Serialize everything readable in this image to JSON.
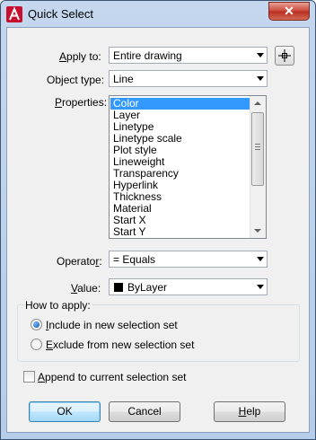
{
  "window": {
    "title": "Quick Select",
    "close_symbol": "✕",
    "app_icon": "autocad-logo-icon"
  },
  "apply_to": {
    "label": "Apply to:",
    "value": "Entire drawing"
  },
  "object_type": {
    "label": "Object type:",
    "value": "Line"
  },
  "properties": {
    "label": "Properties:",
    "items": [
      "Color",
      "Layer",
      "Linetype",
      "Linetype scale",
      "Plot style",
      "Lineweight",
      "Transparency",
      "Hyperlink",
      "Thickness",
      "Material",
      "Start X",
      "Start Y"
    ],
    "selected": "Color"
  },
  "operator": {
    "label": "Operator:",
    "value": "= Equals"
  },
  "value": {
    "label": "Value:",
    "value": "ByLayer",
    "swatch_color": "#000000"
  },
  "how_to_apply": {
    "title": "How to apply:",
    "include_label": "Include in new selection set",
    "exclude_label": "Exclude from new selection set",
    "selected": "include"
  },
  "append": {
    "label": "Append to current selection set",
    "checked": false
  },
  "buttons": {
    "ok": "OK",
    "cancel": "Cancel",
    "help": "Help"
  }
}
